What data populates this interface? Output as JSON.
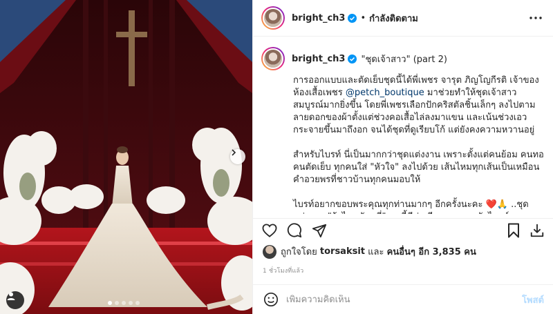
{
  "post": {
    "username": "bright_ch3",
    "follow_label": "กำลังติดตาม",
    "separator": "•",
    "title": "\"ชุดเจ้าสาว\" (part 2)",
    "caption": {
      "p1_before": "การออกแบบและตัดเย็บชุดนี้ได้พี่เพชร จารุต ภิญโญกีรติ เจ้าของห้องเสื้อเพชร ",
      "mention": "@petch_boutique",
      "p1_after": " มาช่วยทำให้ชุดเจ้าสาวสมบูรณ์มากยิ่งขึ้น โดยพี่เพชรเลือกปักคริสตัลชิ้นเล็กๆ ลงไปตามลายดอกของผ้าตั้งแต่ช่วงคอเสื้อไล่ลงมาแขน และเน้นช่วงเอวกระจายขึ้นมาถึงอก จนได้ชุดที่ดูเรียบโก้ แต่ยังคงความหวานอยู่",
      "p2": "สำหรับไบรท์ นี่เป็นมากกว่าชุดแต่งงาน เพราะตั้งแต่คนย้อม คนทอ คนตัดเย็บ ทุกคนใส่ \"หัวใจ\" ลงไปด้วย เส้นไหมทุกเส้นเป็นเหมือนคำอวยพรที่ชาวบ้านทุกคนมอบให้",
      "p3": "ไบรท์อยากขอบพระคุณทุกท่านมากๆ อีกครั้งนะคะ ❤️🙏 ..ชุดแต่งงาน \"ผ้าไหมมัดหมี่\" ชุดนี้มีค่า มีความหมายกับไบรท์มาก และไบรท์เชื่อว่า แม่ภูมิใจที่ลูกสาวเลือกใส่ชุด \"ผ้าไหมมัดหมี่\" ในวันสำคัญ"
    },
    "likes": {
      "prefix": "ถูกใจโดย",
      "user": "torsaksit",
      "middle": "และ",
      "others": "คนอื่นๆ อีก 3,835 คน"
    },
    "time_ago": "1 ชั่วโมงที่แล้ว"
  },
  "comment": {
    "placeholder": "เพิ่มความคิดเห็น",
    "post_label": "โพสต์"
  },
  "carousel": {
    "total": 5,
    "active_index": 0
  },
  "colors": {
    "verified": "#0095f6",
    "link": "#00376b",
    "post_disabled": "#b3dbff",
    "muted": "#8e8e8e"
  },
  "icons": [
    "more-icon",
    "heart-icon",
    "comment-icon",
    "share-icon",
    "bookmark-icon",
    "download-icon",
    "emoji-icon",
    "chevron-right-icon",
    "user-tag-icon",
    "verified-icon"
  ]
}
